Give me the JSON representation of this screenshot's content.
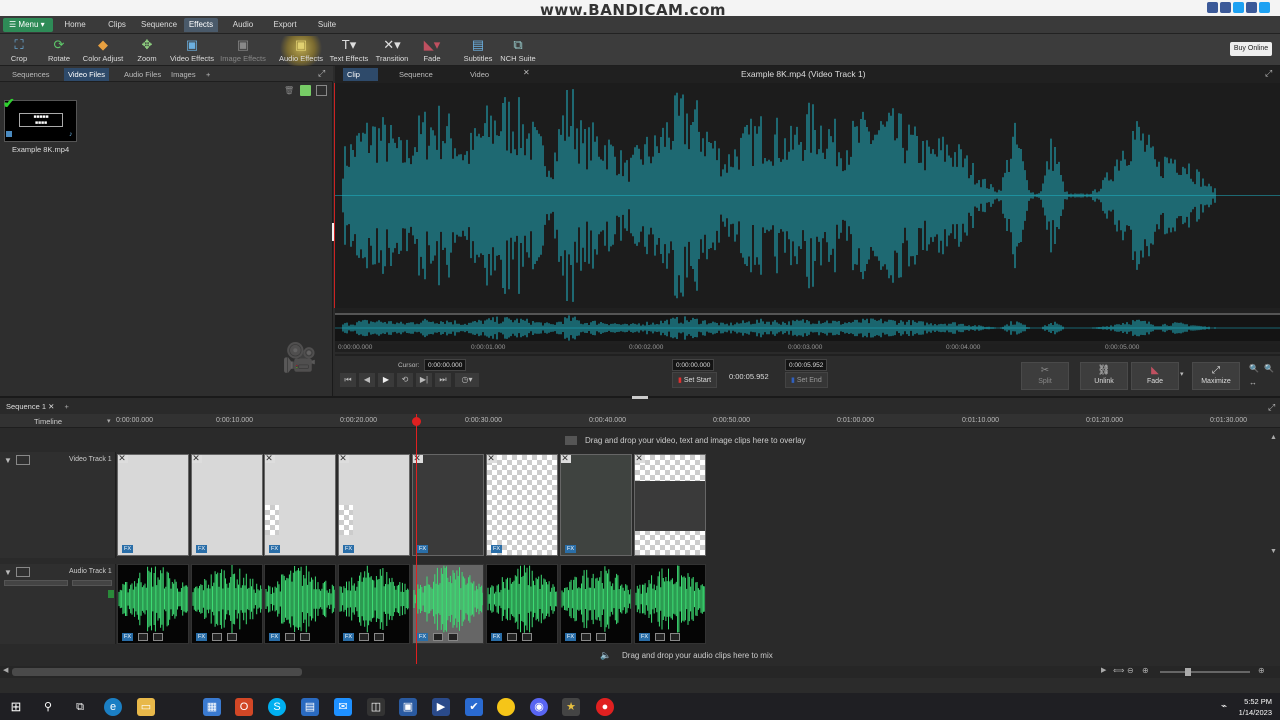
{
  "watermark": "www.BANDICAM.com",
  "menubar": {
    "menu_label": "Menu",
    "tabs": [
      "Home",
      "Clips",
      "Sequence",
      "Effects",
      "Audio",
      "Export",
      "Suite"
    ],
    "active_tab": "Effects"
  },
  "toolbar": {
    "tools": [
      {
        "label": "Crop",
        "icon": "crop-icon"
      },
      {
        "label": "Rotate",
        "icon": "rotate-icon"
      },
      {
        "label": "Color Adjust",
        "icon": "color-adjust-icon"
      },
      {
        "label": "Zoom",
        "icon": "zoom-icon"
      },
      {
        "label": "Video Effects",
        "icon": "video-effects-icon"
      },
      {
        "label": "Image Effects",
        "icon": "image-effects-icon"
      },
      {
        "label": "Audio Effects",
        "icon": "audio-effects-icon"
      },
      {
        "label": "Text Effects",
        "icon": "text-effects-icon"
      },
      {
        "label": "Transition",
        "icon": "transition-icon"
      },
      {
        "label": "Fade",
        "icon": "fade-icon"
      },
      {
        "label": "Subtitles",
        "icon": "subtitles-icon"
      },
      {
        "label": "NCH Suite",
        "icon": "nch-suite-icon"
      }
    ],
    "buy_online": "Buy Online"
  },
  "bin": {
    "tabs": [
      "Sequences",
      "Video Files",
      "Audio Files",
      "Images",
      "+"
    ],
    "active_tab": "Video Files",
    "items": [
      {
        "name": "Example 8K.mp4"
      }
    ]
  },
  "preview": {
    "tabs": [
      "Clip Preview",
      "Sequence Preview",
      "Video Tutorials"
    ],
    "active_tab": "Clip Preview",
    "title": "Example 8K.mp4 (Video Track 1)",
    "ruler_ticks": [
      "0:00:00.000",
      "0:00:01.000",
      "0:00:02.000",
      "0:00:03.000",
      "0:00:04.000",
      "0:00:05.000"
    ],
    "cursor_label": "Cursor:",
    "cursor_value": "0:00:00.000",
    "start_value": "0:00:00.000",
    "duration_value": "0:00:05.952",
    "end_value": "0:00:05.952",
    "set_start": "Set Start",
    "set_end": "Set End",
    "buttons": [
      "Split",
      "Unlink",
      "Fade",
      "Maximize"
    ]
  },
  "timeline": {
    "sequence_tab": "Sequence 1",
    "timeline_label": "Timeline",
    "ruler_ticks": [
      "0:00:00.000",
      "0:00:10.000",
      "0:00:20.000",
      "0:00:30.000",
      "0:00:40.000",
      "0:00:50.000",
      "0:01:00.000",
      "0:01:10.000",
      "0:01:20.000",
      "0:01:30.000"
    ],
    "overlay_msg": "Drag and drop your video, text and image clips here to overlay",
    "video_track": "Video Track 1",
    "audio_track": "Audio Track 1",
    "audio_msg": "Drag and drop your audio clips here to mix",
    "fx_label": "FX"
  },
  "taskbar": {
    "time": "5:52 PM",
    "date": "1/14/2023"
  },
  "colors": {
    "waveform_preview": "#1fb6c9",
    "waveform_timeline": "#3ddc73",
    "playhead": "#e02020",
    "accent_tab": "#2e4a6a"
  }
}
